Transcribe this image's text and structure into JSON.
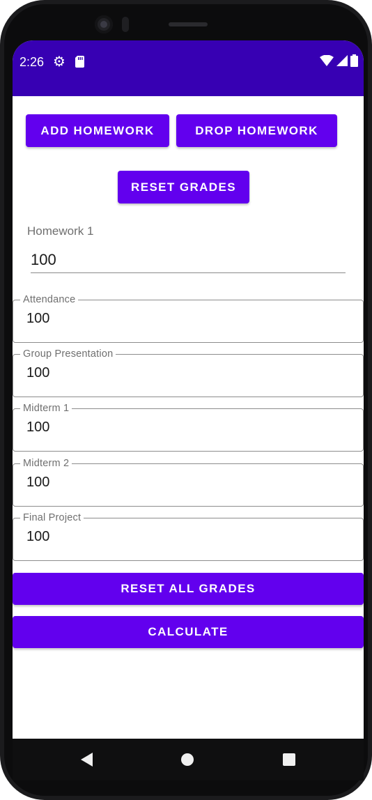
{
  "status_bar": {
    "time": "2:26",
    "icons": [
      "gear-icon",
      "sd-card-icon",
      "wifi-icon",
      "signal-icon",
      "battery-icon"
    ],
    "color": "#3700b3"
  },
  "buttons": {
    "add_homework": "ADD HOMEWORK",
    "drop_homework": "DROP HOMEWORK",
    "reset_grades": "RESET GRADES",
    "reset_all_grades": "RESET ALL GRADES",
    "calculate": "CALCULATE",
    "color": "#6200ee"
  },
  "homework": {
    "label": "Homework 1",
    "value": "100"
  },
  "fields": [
    {
      "label": "Attendance",
      "value": "100"
    },
    {
      "label": "Group Presentation",
      "value": "100"
    },
    {
      "label": "Midterm 1",
      "value": "100"
    },
    {
      "label": "Midterm 2",
      "value": "100"
    },
    {
      "label": "Final Project",
      "value": "100"
    }
  ],
  "nav": {
    "icons": [
      "back-icon",
      "home-icon",
      "recent-apps-icon"
    ]
  }
}
